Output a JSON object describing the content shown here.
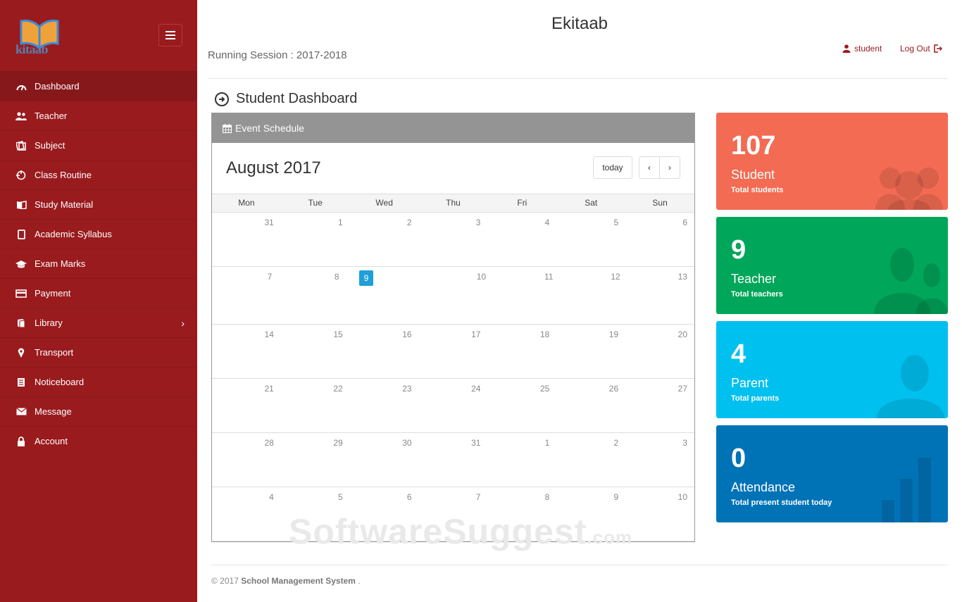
{
  "header": {
    "app_title": "Ekitaab",
    "session": "Running Session : 2017-2018",
    "user_label": "student",
    "logout_label": "Log Out"
  },
  "logo": {
    "text": "kitaab"
  },
  "sidebar": {
    "items": [
      {
        "label": "Dashboard",
        "icon": "speedometer-icon"
      },
      {
        "label": "Teacher",
        "icon": "users-icon"
      },
      {
        "label": "Subject",
        "icon": "book-outline-icon"
      },
      {
        "label": "Class Routine",
        "icon": "target-icon"
      },
      {
        "label": "Study Material",
        "icon": "open-book-icon"
      },
      {
        "label": "Academic Syllabus",
        "icon": "tablet-icon"
      },
      {
        "label": "Exam Marks",
        "icon": "graduation-cap-icon"
      },
      {
        "label": "Payment",
        "icon": "credit-card-icon"
      },
      {
        "label": "Library",
        "icon": "books-icon"
      },
      {
        "label": "Transport",
        "icon": "map-pin-icon"
      },
      {
        "label": "Noticeboard",
        "icon": "document-icon"
      },
      {
        "label": "Message",
        "icon": "envelope-icon"
      },
      {
        "label": "Account",
        "icon": "lock-icon"
      }
    ]
  },
  "page": {
    "title": "Student Dashboard"
  },
  "calendar": {
    "panel_title": "Event Schedule",
    "month_title": "August 2017",
    "today_label": "today",
    "prev_label": "‹",
    "next_label": "›",
    "days_of_week": [
      "Mon",
      "Tue",
      "Wed",
      "Thu",
      "Fri",
      "Sat",
      "Sun"
    ],
    "weeks": [
      [
        "31",
        "1",
        "2",
        "3",
        "4",
        "5",
        "6"
      ],
      [
        "7",
        "8",
        "9",
        "10",
        "11",
        "12",
        "13"
      ],
      [
        "14",
        "15",
        "16",
        "17",
        "18",
        "19",
        "20"
      ],
      [
        "21",
        "22",
        "23",
        "24",
        "25",
        "26",
        "27"
      ],
      [
        "28",
        "29",
        "30",
        "31",
        "1",
        "2",
        "3"
      ],
      [
        "4",
        "5",
        "6",
        "7",
        "8",
        "9",
        "10"
      ]
    ],
    "today": "9"
  },
  "cards": [
    {
      "number": "107",
      "label": "Student",
      "sub": "Total students",
      "color": "#f26b52",
      "icon": "group-icon"
    },
    {
      "number": "9",
      "label": "Teacher",
      "sub": "Total teachers",
      "color": "#00a65a",
      "icon": "two-people-icon"
    },
    {
      "number": "4",
      "label": "Parent",
      "sub": "Total parents",
      "color": "#00c0ef",
      "icon": "person-icon"
    },
    {
      "number": "0",
      "label": "Attendance",
      "sub": "Total present student today",
      "color": "#0073b7",
      "icon": "bar-chart-icon"
    }
  ],
  "watermark": {
    "main": "SoftwareSuggest",
    "suffix": ".com"
  },
  "footer": {
    "prefix": "© 2017",
    "name": "School Management System",
    "suffix": "."
  }
}
